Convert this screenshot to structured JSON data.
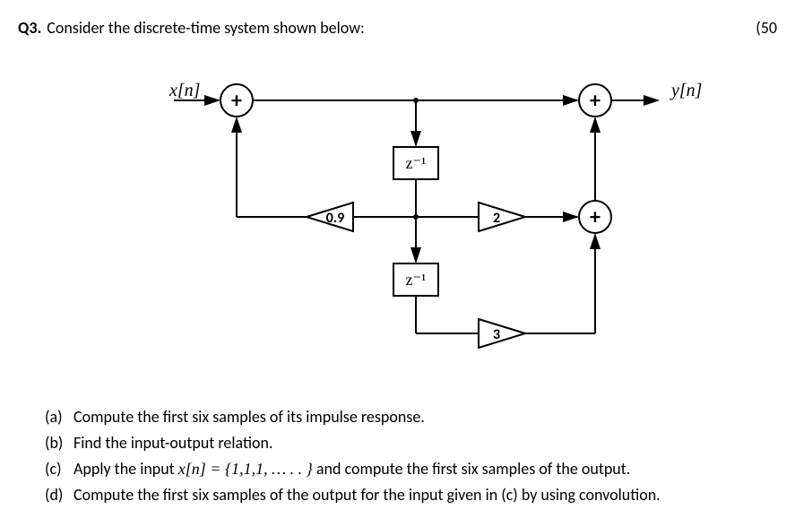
{
  "header": {
    "q_num": "Q3.",
    "prompt": "Consider the discrete-time system shown below:",
    "marks": "(50"
  },
  "diagram": {
    "input_label": "x[n]",
    "output_label": "y[n]",
    "sum1_symbol": "+",
    "sum2_symbol": "+",
    "sum3_symbol": "+",
    "delay1_label": "z⁻¹",
    "delay2_label": "z⁻¹",
    "gain_feedback": "0.9",
    "gain_ff1": "2",
    "gain_ff2": "3"
  },
  "parts": {
    "a": {
      "label": "(a)",
      "text": "Compute the first six samples of its impulse response."
    },
    "b": {
      "label": "(b)",
      "text": "Find the input-output relation."
    },
    "c": {
      "label": "(c)",
      "text_prefix": "Apply the input ",
      "math": "x[n] = {1,1,1, … . . }",
      "text_suffix": " and compute the first six samples of the output."
    },
    "d": {
      "label": "(d)",
      "text": "Compute the first six samples of the output for the input given in (c) by using convolution."
    }
  }
}
